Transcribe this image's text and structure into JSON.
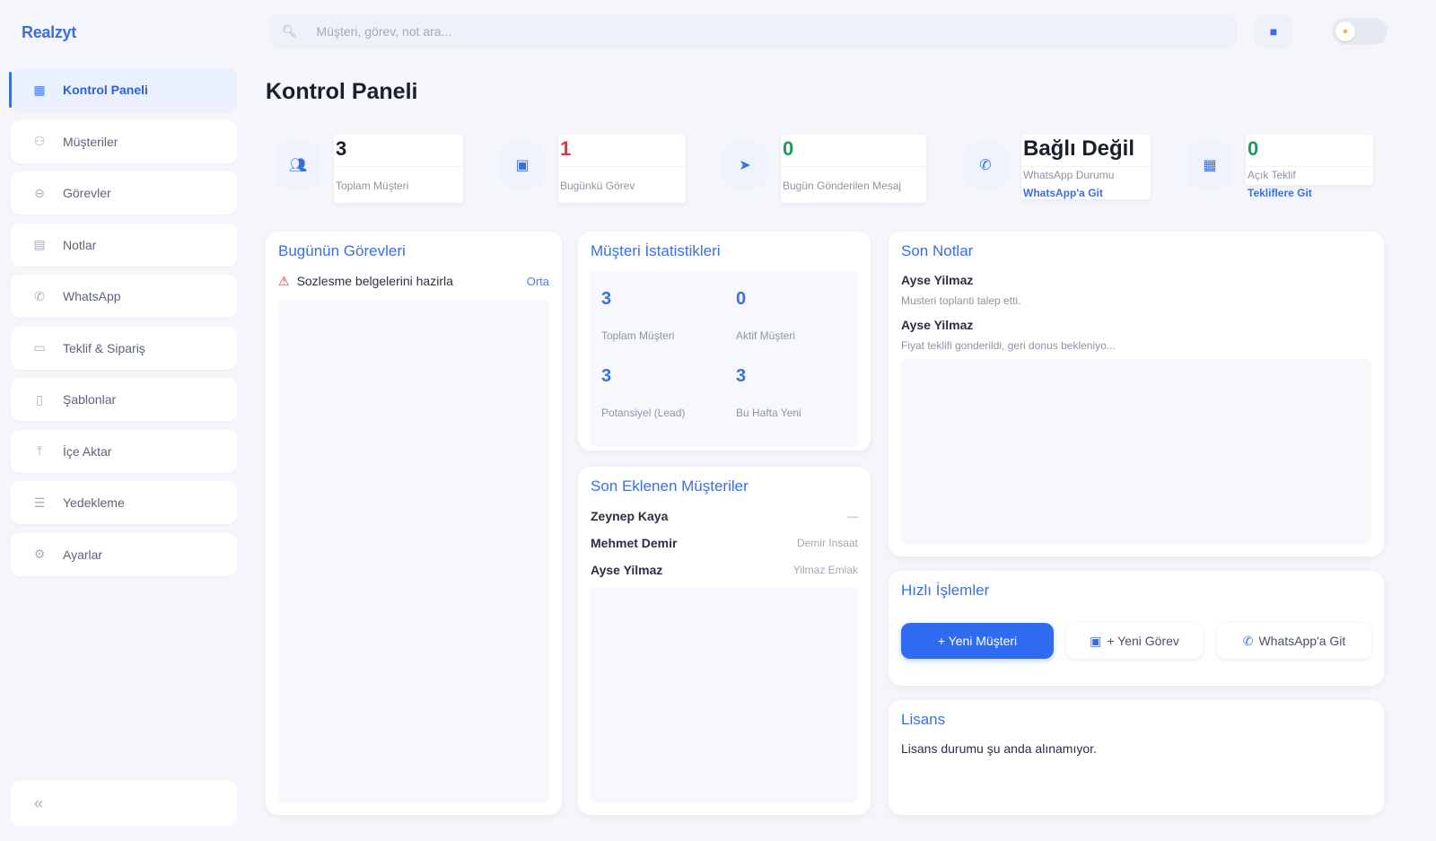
{
  "app": {
    "brand": "Realzyt"
  },
  "sidebar": {
    "items": [
      {
        "label": "Kontrol Paneli",
        "icon": "grid-icon",
        "active": true
      },
      {
        "label": "Müşteriler",
        "icon": "users-icon",
        "active": false
      },
      {
        "label": "Görevler",
        "icon": "check-circle-icon",
        "active": false
      },
      {
        "label": "Notlar",
        "icon": "note-icon",
        "active": false
      },
      {
        "label": "WhatsApp",
        "icon": "whatsapp-icon",
        "active": false
      },
      {
        "label": "Teklif & Sipariş",
        "icon": "card-icon",
        "active": false
      },
      {
        "label": "Şablonlar",
        "icon": "file-icon",
        "active": false
      },
      {
        "label": "İçe Aktar",
        "icon": "upload-icon",
        "active": false
      },
      {
        "label": "Yedekleme",
        "icon": "database-icon",
        "active": false
      },
      {
        "label": "Ayarlar",
        "icon": "gear-icon",
        "active": false
      }
    ],
    "collapse_label": "«"
  },
  "header": {
    "search_placeholder": "Müşteri, görev, not ara...",
    "page_title": "Kontrol Paneli"
  },
  "stats": [
    {
      "value": "3",
      "label": "Toplam Müşteri",
      "link": "",
      "color": "#1a1f2b"
    },
    {
      "value": "1",
      "label": "Bugünkü Görev",
      "link": "",
      "color": "#e0353a"
    },
    {
      "value": "0",
      "label": "Bugün Gönderilen Mesaj",
      "link": "",
      "color": "#1f9a5a"
    },
    {
      "value": "Bağlı Değil",
      "label": "WhatsApp Durumu",
      "link": "WhatsApp'a Git",
      "color": "#1a1f2b"
    },
    {
      "value": "0",
      "label": "Açık Teklif",
      "link": "Tekliflere Git",
      "color": "#1f9a5a"
    }
  ],
  "today_tasks": {
    "title": "Bugünün Görevleri",
    "items": [
      {
        "text": "Sozlesme belgelerini hazirla",
        "priority": "Orta"
      }
    ]
  },
  "customer_stats": {
    "title": "Müşteri İstatistikleri",
    "cells": [
      {
        "value": "3",
        "label": "Toplam Müşteri"
      },
      {
        "value": "0",
        "label": "Aktif Müşteri"
      },
      {
        "value": "3",
        "label": "Potansiyel (Lead)"
      },
      {
        "value": "3",
        "label": "Bu Hafta Yeni"
      }
    ]
  },
  "recent_customers": {
    "title": "Son Eklenen Müşteriler",
    "items": [
      {
        "name": "Zeynep Kaya",
        "company": "—"
      },
      {
        "name": "Mehmet Demir",
        "company": "Demir Insaat"
      },
      {
        "name": "Ayse Yilmaz",
        "company": "Yilmaz Emlak"
      }
    ]
  },
  "recent_notes": {
    "title": "Son Notlar",
    "items": [
      {
        "author": "Ayse Yilmaz",
        "text": "Musteri toplanti talep etti."
      },
      {
        "author": "Ayse Yilmaz",
        "text": "Fiyat teklifi gonderildi, geri donus bekleniyo..."
      }
    ]
  },
  "quick_actions": {
    "title": "Hızlı İşlemler",
    "buttons": [
      "+ Yeni Müşteri",
      "+ Yeni Görev",
      "WhatsApp'a Git"
    ]
  },
  "license": {
    "title": "Lisans",
    "text": "Lisans durumu şu anda alınamıyor."
  }
}
